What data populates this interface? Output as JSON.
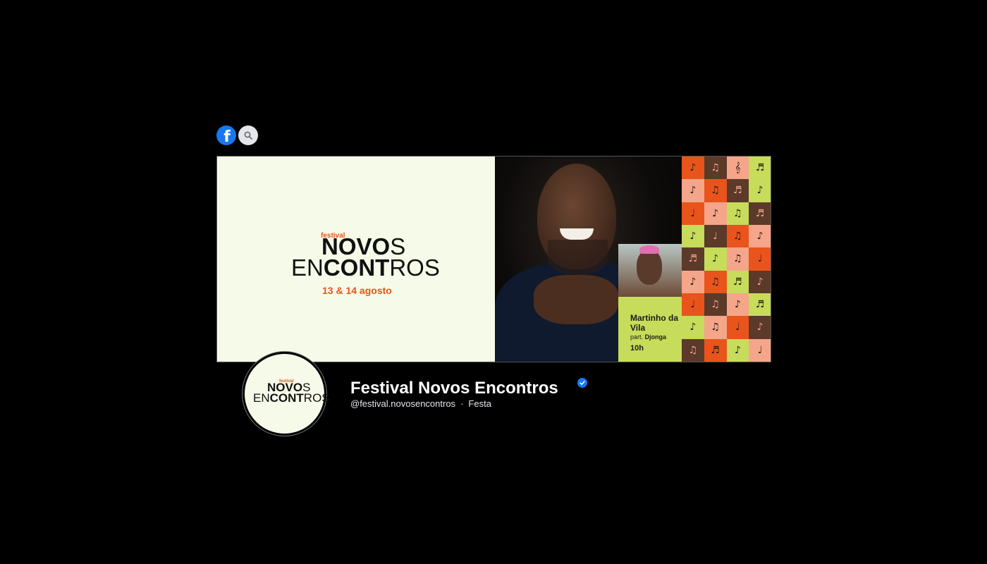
{
  "header": {
    "facebook_logo_glyph": "f",
    "search_icon": "search-icon"
  },
  "cover": {
    "logo_small": "festival",
    "logo_line1_bold": "NOVO",
    "logo_line1_light": "S",
    "logo_line2_a": "EN",
    "logo_line2_b": "CONT",
    "logo_line2_c": "ROS",
    "date": "13 & 14 agosto",
    "promo": {
      "name": "Martinho da Vila",
      "part_prefix": "part.",
      "part_name": "Djonga",
      "time": "10h"
    },
    "pattern_icons": [
      "♪",
      "♫",
      "𝄞",
      "♬",
      "♪",
      "♫",
      "♬",
      "♪",
      "♩",
      "♪",
      "♫",
      "♬",
      "♪",
      "♩",
      "♫",
      "♪",
      "♬",
      "♪",
      "♫",
      "♩",
      "♪",
      "♫",
      "♬",
      "♪",
      "♩",
      "♫",
      "♪",
      "♬",
      "♪",
      "♫",
      "♩",
      "♪",
      "♫",
      "♬",
      "♪",
      "♩"
    ],
    "pattern_colors": [
      "#e8541b",
      "#5b3a2a",
      "#f4a58a",
      "#c6dc5a",
      "#f4a58a",
      "#e8541b",
      "#5b3a2a",
      "#c6dc5a",
      "#e8541b",
      "#f4a58a",
      "#c6dc5a",
      "#5b3a2a",
      "#c6dc5a",
      "#5b3a2a",
      "#e8541b",
      "#f4a58a",
      "#5b3a2a",
      "#c6dc5a",
      "#f4a58a",
      "#e8541b",
      "#f4a58a",
      "#e8541b",
      "#c6dc5a",
      "#5b3a2a",
      "#e8541b",
      "#5b3a2a",
      "#f4a58a",
      "#c6dc5a",
      "#c6dc5a",
      "#f4a58a",
      "#e8541b",
      "#5b3a2a",
      "#5b3a2a",
      "#e8541b",
      "#c6dc5a",
      "#f4a58a"
    ]
  },
  "profile": {
    "avatar_logo_small": "festival",
    "avatar_line1_bold": "NOVO",
    "avatar_line1_light": "S",
    "avatar_line2_a": "EN",
    "avatar_line2_b": "CONT",
    "avatar_line2_c": "ROS",
    "name": "Festival Novos Encontros",
    "handle": "@festival.novosencontros",
    "separator": "·",
    "category": "Festa",
    "verified": true
  },
  "colors": {
    "accent_orange": "#e8541b",
    "facebook_blue": "#1877f2",
    "cover_bg": "#f6fbe9",
    "promo_green": "#c6dc5a"
  }
}
